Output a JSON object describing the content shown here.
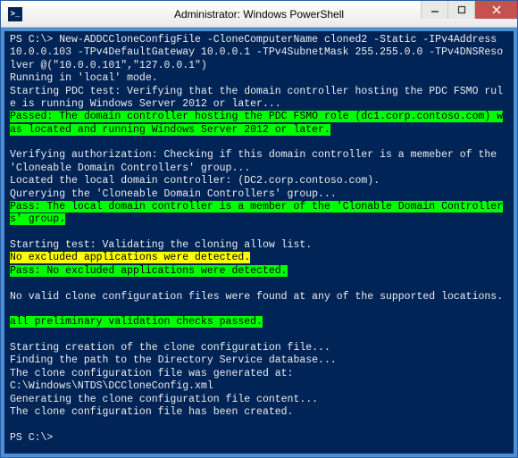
{
  "window": {
    "title": "Administrator: Windows PowerShell",
    "icon_label": ">_"
  },
  "console": {
    "prompt1": "PS C:\\> ",
    "command": "New-ADDCCloneConfigFile -CloneComputerName cloned2 -Static -IPv4Address 10.0.0.103 -TPv4DefaultGateway 10.0.0.1 -TPv4SubnetMask 255.255.0.0 -TPv4DNSResolver @(\"10.0.0.101\",\"127.0.0.1\")",
    "l_running": "Running in 'local' mode.",
    "l_start_pdc": "Starting PDC test: Verifying that the domain controller hosting the PDC FSMO rule is running Windows Server 2012 or later...",
    "l_pass_pdc": "Passed: The domain controller hosting the PDC FSMO role (dc1.corp.contoso.com) was located and running Windows Server 2012 or later.",
    "l_verify_auth": "Verifying authorization: Checking if this domain controller is a memeber of the 'Cloneable Domain Controllers' group...",
    "l_located": "Located the local domain controller: (DC2.corp.contoso.com).",
    "l_querying": "Qurerying the 'Cloneable Domain Controllers' group...",
    "l_pass_member": "Pass: The local domain controller is a member of the 'Clonable Domain Controllers' group.",
    "l_start_allow": "Starting test: Validating the cloning allow list.",
    "l_no_excluded": "No excluded applications were detected.",
    "l_pass_excluded": "Pass: No excluded applications were detected.",
    "l_no_valid": "No valid clone configuration files were found at any of the supported locations.",
    "l_all_prelim": "all preliminary validation checks passed.",
    "l_start_create": "Starting creation of the clone configuration file...",
    "l_finding": "Finding the path to the Directory Service database...",
    "l_gen_at": "The clone configuration file was generated at:",
    "l_path": "C:\\Windows\\NTDS\\DCCloneConfig.xml",
    "l_gen_content": "Generating the clone configuration file content...",
    "l_created": "The clone configuration file has been created.",
    "prompt2": "PS C:\\>"
  }
}
